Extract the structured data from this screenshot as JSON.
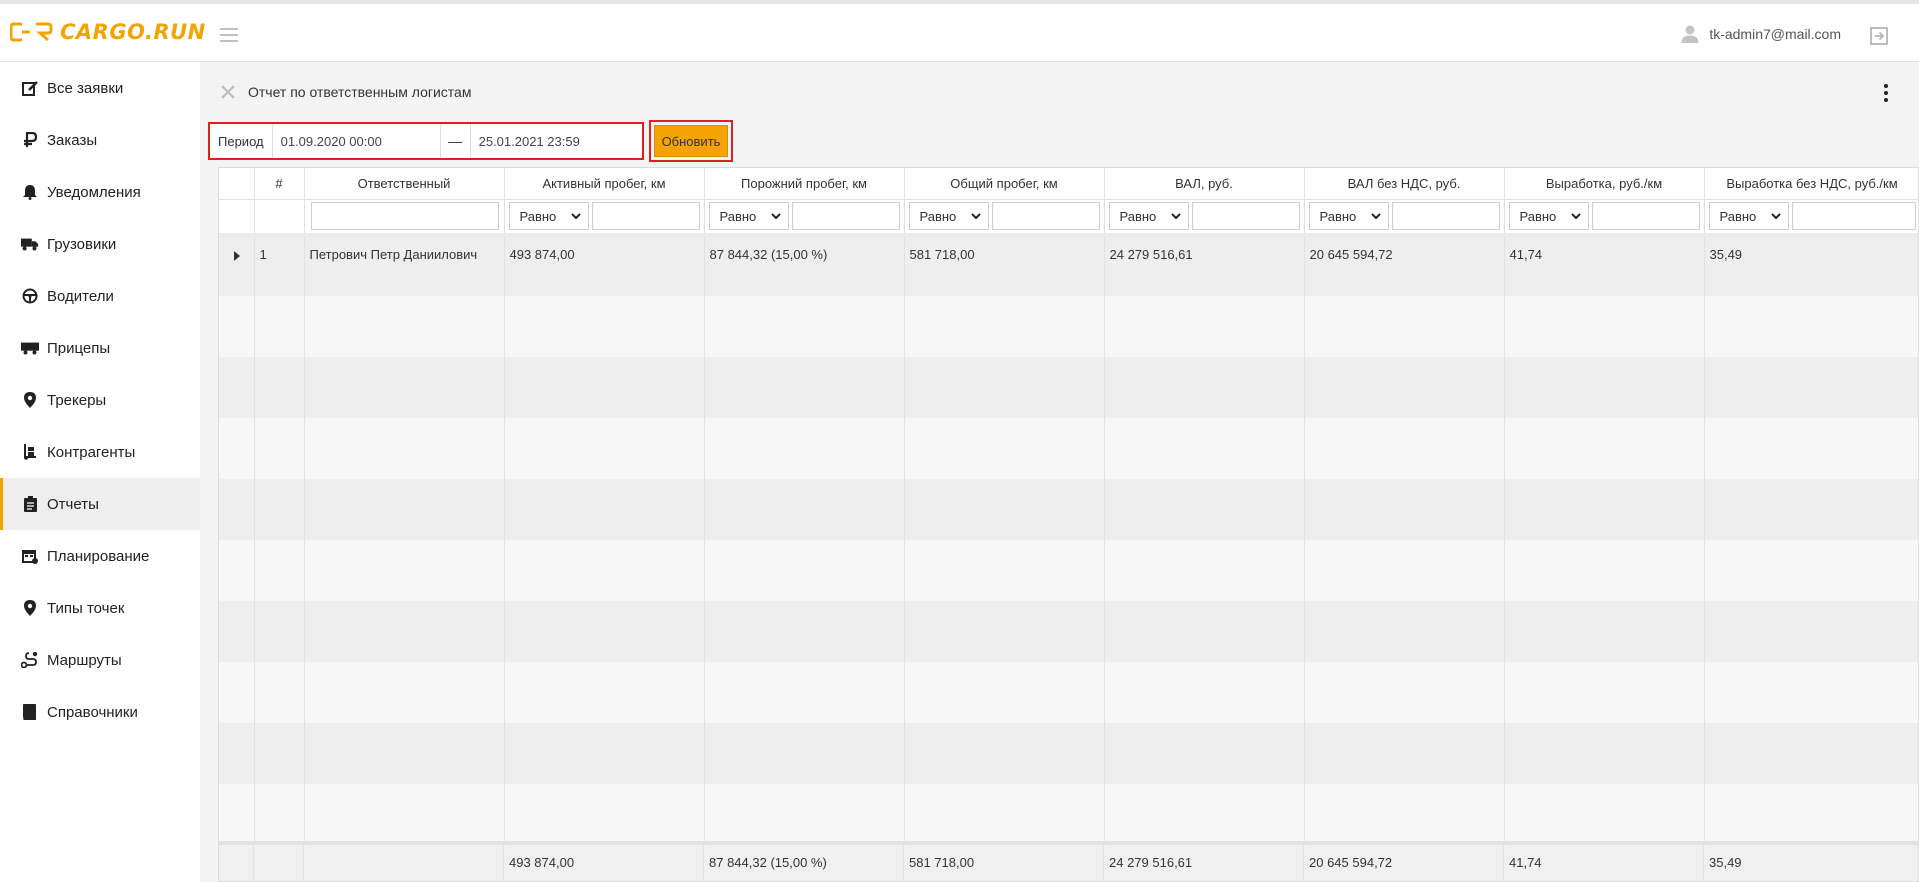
{
  "header": {
    "logo_text": "CARGO.RUN",
    "user_email": "tk-admin7@mail.com",
    "icons": [
      "logo-mark-icon",
      "hamburger-icon",
      "user-icon",
      "logout-icon"
    ]
  },
  "sidebar": {
    "items": [
      {
        "label": "Все заявки",
        "icon": "edit-icon",
        "active": false
      },
      {
        "label": "Заказы",
        "icon": "ruble-icon",
        "active": false
      },
      {
        "label": "Уведомления",
        "icon": "bell-icon",
        "active": false
      },
      {
        "label": "Грузовики",
        "icon": "truck-icon",
        "active": false
      },
      {
        "label": "Водители",
        "icon": "steering-wheel-icon",
        "active": false
      },
      {
        "label": "Прицепы",
        "icon": "trailer-icon",
        "active": false
      },
      {
        "label": "Трекеры",
        "icon": "map-pin-icon",
        "active": false
      },
      {
        "label": "Контрагенты",
        "icon": "dolly-icon",
        "active": false
      },
      {
        "label": "Отчеты",
        "icon": "clipboard-icon",
        "active": true
      },
      {
        "label": "Планирование",
        "icon": "calendar-icon",
        "active": false
      },
      {
        "label": "Типы точек",
        "icon": "map-pin-icon",
        "active": false
      },
      {
        "label": "Маршруты",
        "icon": "route-icon",
        "active": false
      },
      {
        "label": "Справочники",
        "icon": "book-icon",
        "active": false
      }
    ]
  },
  "page": {
    "title": "Отчет по ответственным логистам",
    "period_label": "Период",
    "date_from": "01.09.2020 00:00",
    "date_separator": "—",
    "date_to": "25.01.2021 23:59",
    "refresh_label": "Обновить"
  },
  "table": {
    "columns": [
      "",
      "#",
      "Ответственный",
      "Активный пробег, км",
      "Порожний пробег, км",
      "Общий пробег, км",
      "ВАЛ, руб.",
      "ВАЛ без НДС, руб.",
      "Выработка, руб./км",
      "Выработка без НДС, руб./км"
    ],
    "filter_option": "Равно",
    "rows": [
      [
        "",
        "1",
        "Петрович Петр Даниилович",
        "493 874,00",
        "87 844,32 (15,00 %)",
        "581 718,00",
        "24 279 516,61",
        "20 645 594,72",
        "41,74",
        "35,49"
      ]
    ],
    "totals": [
      "",
      "",
      "",
      "493 874,00",
      "87 844,32 (15,00 %)",
      "581 718,00",
      "24 279 516,61",
      "20 645 594,72",
      "41,74",
      "35,49"
    ]
  },
  "colors": {
    "accent": "#f4a402",
    "highlight_border": "#e02020"
  }
}
